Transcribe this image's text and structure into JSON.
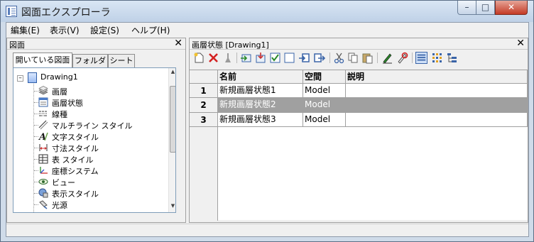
{
  "window": {
    "title": "図面エクスプローラ",
    "buttons": {
      "minimize": "–",
      "maximize": "□",
      "close": "✕"
    }
  },
  "menu": [
    "編集(E)",
    "表示(V)",
    "設定(S)",
    "ヘルプ(H)"
  ],
  "left_pane": {
    "title": "図面",
    "close": "✕",
    "tabs": [
      "開いている図面",
      "フォルダ",
      "シート"
    ],
    "tree": {
      "root_expander": "–",
      "root": "Drawing1",
      "items": [
        {
          "label": "画層",
          "icon": "layers-icon"
        },
        {
          "label": "画層状態",
          "icon": "layer-states-icon"
        },
        {
          "label": "線種",
          "icon": "linetype-icon"
        },
        {
          "label": "マルチライン スタイル",
          "icon": "multiline-style-icon"
        },
        {
          "label": "文字スタイル",
          "icon": "text-style-icon"
        },
        {
          "label": "寸法スタイル",
          "icon": "dimension-style-icon"
        },
        {
          "label": "表 スタイル",
          "icon": "table-style-icon"
        },
        {
          "label": "座標システム",
          "icon": "ucs-icon"
        },
        {
          "label": "ビュー",
          "icon": "view-icon"
        },
        {
          "label": "表示スタイル",
          "icon": "visual-style-icon"
        },
        {
          "label": "光源",
          "icon": "light-icon"
        }
      ]
    }
  },
  "right_pane": {
    "title": "画層状態 [Drawing1]",
    "close": "✕",
    "toolbar_icons": [
      "new-icon",
      "delete-icon",
      "purge-icon",
      "import-icon",
      "export-icon",
      "check-icon",
      "uncheck-icon",
      "restore-icon",
      "apply-icon",
      "cut-icon",
      "copy-icon",
      "paste-icon",
      "edit-icon",
      "rename-icon",
      "list-view-icon",
      "icon-view-icon",
      "tree-view-icon"
    ],
    "table": {
      "columns": [
        "名前",
        "空間",
        "説明"
      ],
      "rows": [
        {
          "num": "1",
          "name": "新規画層状態1",
          "space": "Model",
          "desc": ""
        },
        {
          "num": "2",
          "name": "新規画層状態2",
          "space": "Model",
          "desc": ""
        },
        {
          "num": "3",
          "name": "新規画層状態3",
          "space": "Model",
          "desc": ""
        }
      ]
    }
  },
  "colors": {
    "selection": "#a0a0a0",
    "close_button": "#c43a25",
    "titlebar": "#cfdbe9"
  }
}
